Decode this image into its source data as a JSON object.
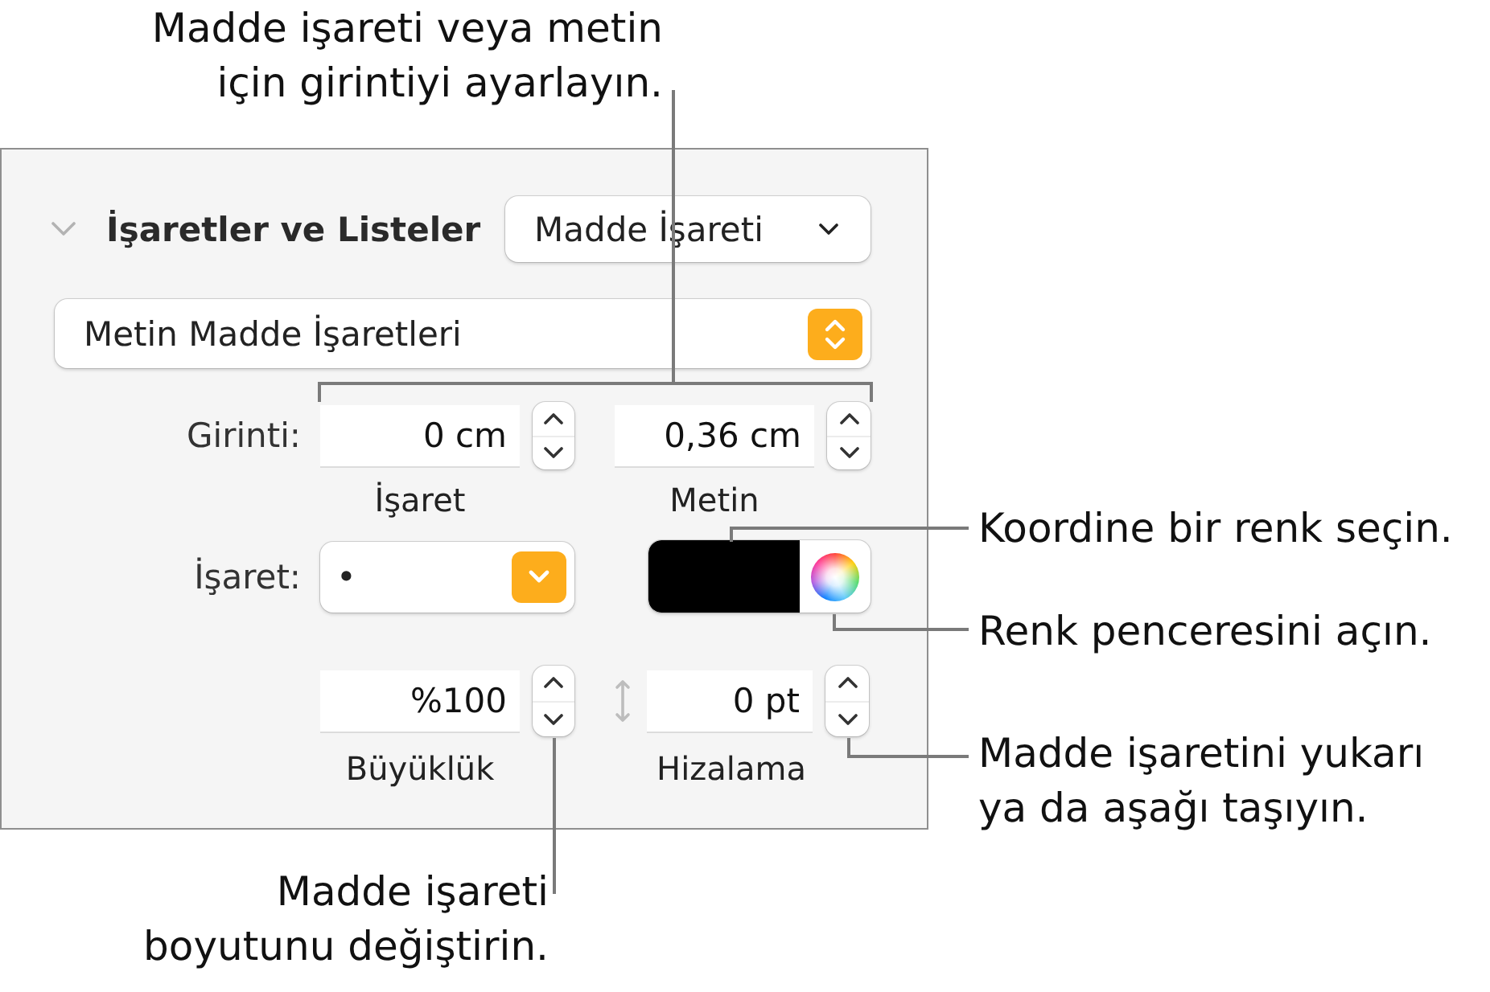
{
  "top_callout": {
    "text": "Madde işareti veya metin\niçin girintiyi ayarlayın."
  },
  "panel": {
    "section": {
      "title": "İşaretler ve Listeler",
      "expanded": true,
      "list_type": "Madde İşareti"
    },
    "bullet_style": "Metin Madde İşaretleri",
    "indent": {
      "label": "Girinti:",
      "fields": [
        {
          "value": "0 cm",
          "caption": "İşaret"
        },
        {
          "value": "0,36 cm",
          "caption": "Metin"
        }
      ]
    },
    "bullet": {
      "label": "İşaret:",
      "value": "•",
      "color": "#000000"
    },
    "size": {
      "value": "%100",
      "caption": "Büyüklük"
    },
    "alignment": {
      "value": "0 pt",
      "caption": "Hizalama"
    }
  },
  "right_callouts": [
    {
      "text": "Koordine bir renk seçin."
    },
    {
      "text": "Renk penceresini açın."
    },
    {
      "text": "Madde işaretini yukarı\nya da aşağı taşıyın."
    }
  ],
  "bottom_callout": {
    "text": "Madde işareti\nboyutunu değiştirin."
  }
}
